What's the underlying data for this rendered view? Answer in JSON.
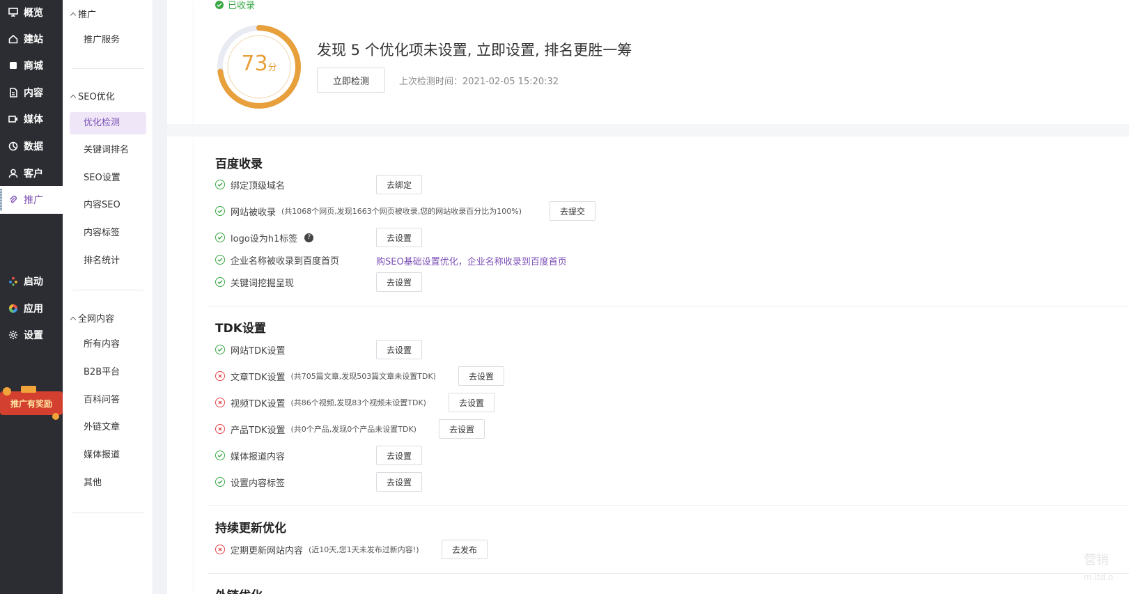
{
  "sidebar": {
    "items": [
      {
        "label": "概览",
        "icon": "overview-icon"
      },
      {
        "label": "建站",
        "icon": "home-icon"
      },
      {
        "label": "商城",
        "icon": "shop-icon"
      },
      {
        "label": "内容",
        "icon": "document-icon"
      },
      {
        "label": "媒体",
        "icon": "video-icon"
      },
      {
        "label": "数据",
        "icon": "chart-pie-icon"
      },
      {
        "label": "客户",
        "icon": "user-icon"
      },
      {
        "label": "推广",
        "icon": "paperclip-icon"
      },
      {
        "label": "启动",
        "icon": "launch-dots-icon"
      },
      {
        "label": "应用",
        "icon": "apps-icon"
      },
      {
        "label": "设置",
        "icon": "gear-icon"
      }
    ],
    "promo_text": "推广有奖励"
  },
  "submenu": {
    "groups": [
      {
        "title": "推广",
        "items": [
          "推广服务"
        ]
      },
      {
        "title": "SEO优化",
        "items": [
          "优化检测",
          "关键词排名",
          "SEO设置",
          "内容SEO",
          "内容标签",
          "排名统计"
        ]
      },
      {
        "title": "全网内容",
        "items": [
          "所有内容",
          "B2B平台",
          "百科问答",
          "外链文章",
          "媒体报道",
          "其他"
        ]
      }
    ]
  },
  "summary": {
    "indexed_label": "已收录",
    "score": "73",
    "score_unit": "分",
    "score_value": 73,
    "score_max": 100,
    "headline": "发现 5 个优化项未设置, 立即设置, 排名更胜一筹",
    "check_button": "立即检测",
    "last_check": "上次检测时间：2021-02-05 15:20:32"
  },
  "sections": {
    "baidu": {
      "title": "百度收录",
      "rows": [
        {
          "label": "绑定顶级域名",
          "status": "ok",
          "action": "去绑定"
        },
        {
          "label": "网站被收录",
          "note": "(共1068个网页,发现1663个网页被收录,您的网站收录百分比为100%)",
          "status": "ok",
          "action": "去提交"
        },
        {
          "label": "logo设为h1标签",
          "status": "ok",
          "action": "去设置"
        },
        {
          "label": "企业名称被收录到百度首页",
          "status": "ok",
          "link": "购SEO基础设置优化，企业名称收录到百度首页"
        },
        {
          "label": "关键词挖掘呈现",
          "status": "ok",
          "action": "去设置"
        }
      ]
    },
    "tdk": {
      "title": "TDK设置",
      "rows": [
        {
          "label": "网站TDK设置",
          "status": "ok",
          "action": "去设置"
        },
        {
          "label": "文章TDK设置",
          "note": "(共705篇文章,发现503篇文章未设置TDK)",
          "status": "err",
          "action": "去设置"
        },
        {
          "label": "视频TDK设置",
          "note": "(共86个视频,发现83个视频未设置TDK)",
          "status": "err",
          "action": "去设置"
        },
        {
          "label": "产品TDK设置",
          "note": "(共0个产品,发现0个产品未设置TDK)",
          "status": "err",
          "action": "去设置"
        },
        {
          "label": "媒体报道内容",
          "status": "ok",
          "action": "去设置"
        },
        {
          "label": "设置内容标签",
          "status": "ok",
          "action": "去设置"
        }
      ]
    },
    "update": {
      "title": "持续更新优化",
      "rows": [
        {
          "label": "定期更新网站内容",
          "note": "(近10天,您1天未发布过新内容!)",
          "status": "err",
          "action": "去发布"
        }
      ]
    },
    "external": {
      "title": "外链优化"
    }
  },
  "watermark": {
    "line1": "营销",
    "line2": "m.ltd.o"
  },
  "colors": {
    "accent": "#7b4fb6",
    "ok": "#3aa845",
    "error": "#e2474c",
    "score": "#e7a03c",
    "sidebar_bg": "#2b2d33"
  }
}
